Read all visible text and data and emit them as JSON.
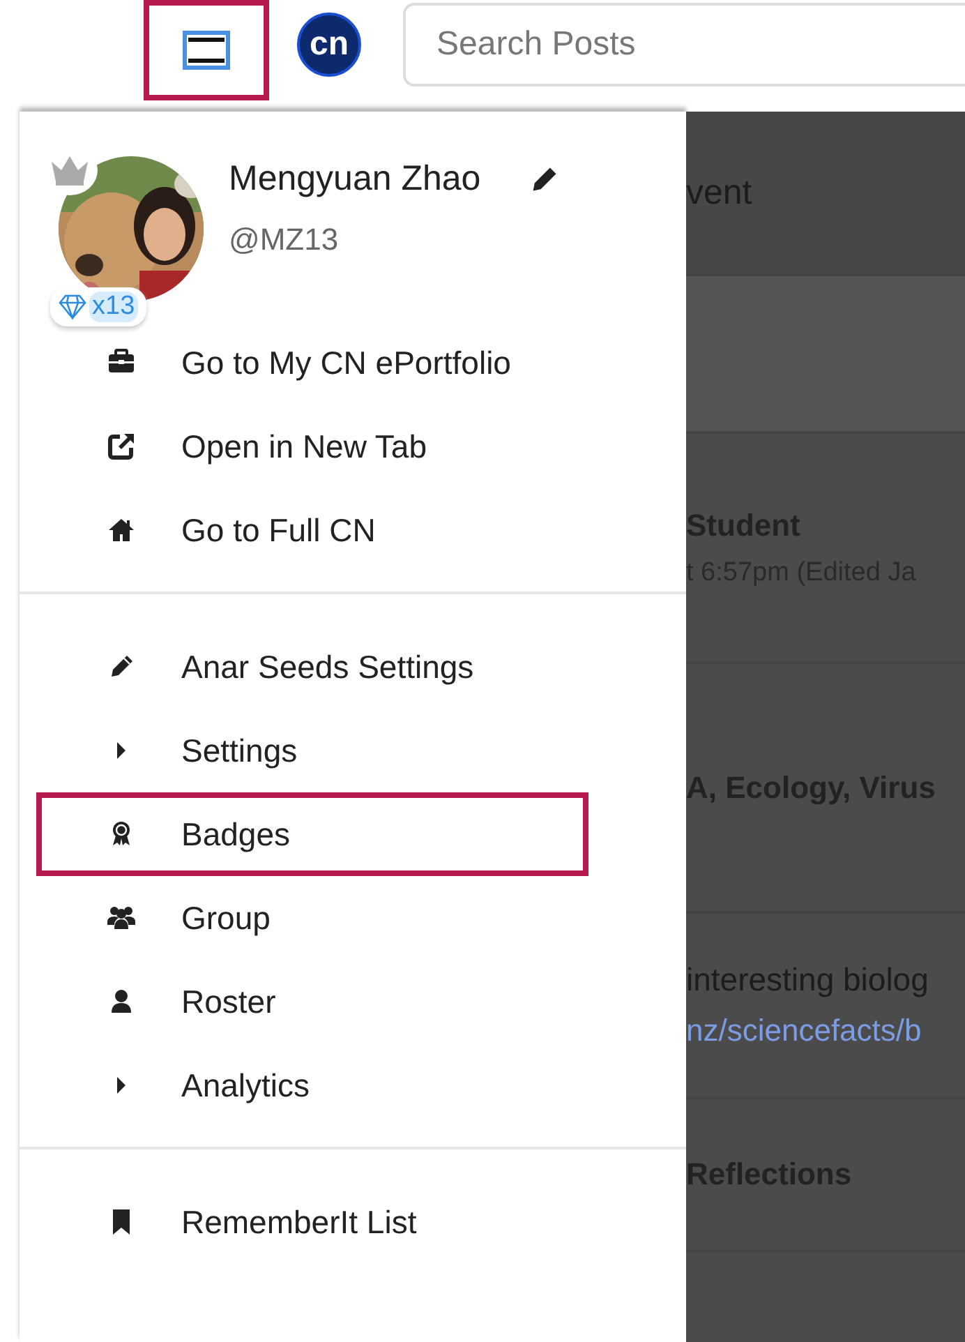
{
  "top_bar": {
    "menu_button": {
      "highlighted": true
    },
    "logo": "cn",
    "search": {
      "placeholder": "Search Posts"
    }
  },
  "profile": {
    "name": "Mengyuan Zhao",
    "handle": "@MZ13",
    "gem_count": "x13"
  },
  "menu_sections": [
    {
      "items": [
        {
          "label": "Go to My CN ePortfolio",
          "kind": "link",
          "highlighted": false
        },
        {
          "label": "Open in New Tab",
          "kind": "link",
          "highlighted": false
        },
        {
          "label": "Go to Full CN",
          "kind": "link",
          "highlighted": false
        }
      ]
    },
    {
      "items": [
        {
          "label": "Anar Seeds Settings",
          "kind": "link",
          "highlighted": false
        },
        {
          "label": "Settings",
          "kind": "submenu",
          "highlighted": false
        },
        {
          "label": "Badges",
          "kind": "link",
          "highlighted": true
        },
        {
          "label": "Group",
          "kind": "link",
          "highlighted": false
        },
        {
          "label": "Roster",
          "kind": "link",
          "highlighted": false
        },
        {
          "label": "Analytics",
          "kind": "submenu",
          "highlighted": false
        }
      ]
    },
    {
      "items": [
        {
          "label": "RememberIt List",
          "kind": "link",
          "highlighted": false
        }
      ]
    }
  ],
  "background_feed": [
    {
      "kind": "header",
      "lines": [
        {
          "text": "vent",
          "kind": "heading"
        }
      ]
    },
    {
      "kind": "band"
    },
    {
      "kind": "card",
      "lines": [
        {
          "text": "Student",
          "kind": "bold"
        },
        {
          "text": "t 6:57pm (Edited Ja",
          "kind": "meta"
        }
      ]
    },
    {
      "kind": "card",
      "lines": [
        {
          "text": "A, Ecology, Virus",
          "kind": "bold"
        }
      ]
    },
    {
      "kind": "card",
      "lines": [
        {
          "text": "interesting biolog",
          "kind": "body"
        },
        {
          "text": "nz/sciencefacts/b",
          "kind": "link"
        }
      ]
    },
    {
      "kind": "card",
      "lines": [
        {
          "text": "Reflections",
          "kind": "bold"
        }
      ]
    }
  ]
}
